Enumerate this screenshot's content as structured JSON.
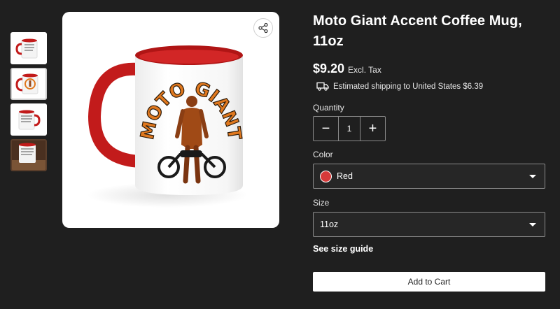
{
  "product": {
    "title": "Moto Giant Accent Coffee Mug, 11oz",
    "price": "$9.20",
    "tax_note": "Excl. Tax",
    "shipping_text": "Estimated shipping to United States $6.39",
    "mug_text": "MOTO GIANT"
  },
  "quantity": {
    "label": "Quantity",
    "value": "1",
    "minus_symbol": "−",
    "plus_symbol": "+"
  },
  "color": {
    "label": "Color",
    "selected": "Red",
    "swatch_hex": "#d63a3a"
  },
  "size": {
    "label": "Size",
    "selected": "11oz",
    "guide_link": "See size guide"
  },
  "cart": {
    "button_label": "Add to Cart"
  },
  "gallery": {
    "thumbnails": [
      "mug-text-front",
      "mug-moto-giant",
      "mug-text-side",
      "mug-lifestyle-dark"
    ],
    "active_index": 1,
    "accent_hex": "#c21b1b"
  }
}
